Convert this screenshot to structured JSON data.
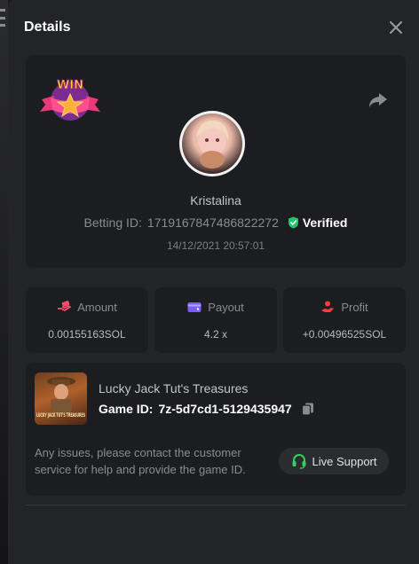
{
  "modal": {
    "title": "Details",
    "close_icon": "close-icon"
  },
  "bet": {
    "badge_text": "WIN",
    "username": "Kristalina",
    "betting_label": "Betting ID:",
    "betting_id": "1719167847486822272",
    "verified_label": "Verified",
    "timestamp": "14/12/2021 20:57:01"
  },
  "stats": [
    {
      "icon": "money-hand-icon",
      "label": "Amount",
      "value": "0.00155163SOL",
      "color": "#ff4d6d"
    },
    {
      "icon": "wallet-icon",
      "label": "Payout",
      "value": "4.2 x",
      "color": "#7b5cff"
    },
    {
      "icon": "profit-hand-icon",
      "label": "Profit",
      "value": "+0.00496525SOL",
      "color": "#ff3b3b"
    }
  ],
  "game": {
    "thumb_text": "LUCKY JACK TUT'S TREASURES",
    "name": "Lucky Jack Tut's Treasures",
    "id_label": "Game ID:",
    "id_value": "7z-5d7cd1-5129435947",
    "support_text": "Any issues, please contact the customer service for help and provide the game ID.",
    "live_support_label": "Live Support"
  },
  "colors": {
    "verified_green": "#1fc76a",
    "support_green": "#2fd35f",
    "badge_pink": "#e8397a",
    "badge_yellow": "#ffc93a"
  }
}
